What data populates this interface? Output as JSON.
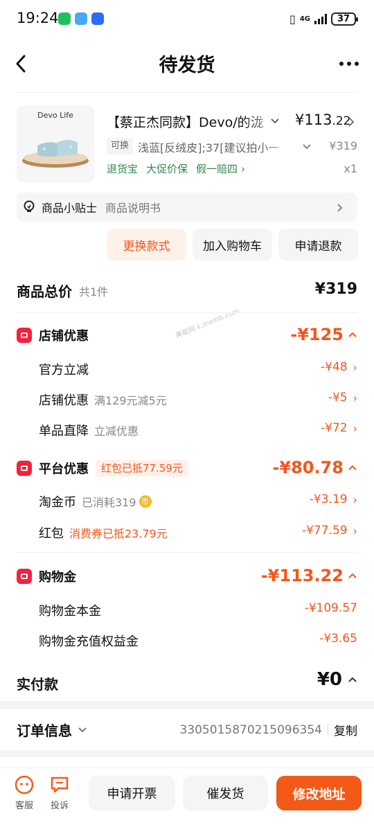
{
  "status_bar": {
    "time": "19:24",
    "network": "4G",
    "battery": "37"
  },
  "nav": {
    "title": "待发货"
  },
  "product": {
    "brand": "Devo Life",
    "title": "【蔡正杰同款】Devo/的泷",
    "price_main": "¥113",
    "price_decimal": ".22",
    "spec_tag": "可换",
    "spec": "浅蓝[反绒皮];37[建议拍小一",
    "original_price": "¥319",
    "service_tags": [
      "退货宝",
      "大促价保",
      "假一赔四"
    ],
    "quantity": "x1"
  },
  "tips": {
    "label": "商品小贴士",
    "sub": "商品说明书"
  },
  "actions": [
    "更换款式",
    "加入购物车",
    "申请退款"
  ],
  "totals": {
    "goods_total_label": "商品总价",
    "goods_total_count": "共1件",
    "goods_total_value": "¥319",
    "watermark": "美能网 k.meinb.com",
    "shop": {
      "label": "店铺优惠",
      "amount": "-¥125",
      "items": [
        {
          "label": "官方立减",
          "note": "",
          "amount": "-¥48"
        },
        {
          "label": "店铺优惠",
          "note": "满129元减5元",
          "amount": "-¥5"
        },
        {
          "label": "单品直降",
          "note": "立减优惠",
          "amount": "-¥72"
        }
      ]
    },
    "platform": {
      "label": "平台优惠",
      "pill": "红包已抵77.59元",
      "amount": "-¥80.78",
      "items": [
        {
          "label": "淘金币",
          "note": "已消耗319",
          "amount": "-¥3.19"
        },
        {
          "label": "红包",
          "note": "消费券已抵23.79元",
          "amount": "-¥77.59"
        }
      ]
    },
    "shopping_money": {
      "label": "购物金",
      "amount": "-¥113.22",
      "items": [
        {
          "label": "购物金本金",
          "amount": "-¥109.57"
        },
        {
          "label": "购物金充值权益金",
          "amount": "-¥3.65"
        }
      ]
    },
    "paid_label": "实付款",
    "paid_value": "¥0"
  },
  "order_info": {
    "label": "订单信息",
    "number": "3305015870215096354",
    "copy": "复制"
  },
  "bottom": {
    "service": "客服",
    "complaint": "投诉",
    "invoice": "申请开票",
    "urge": "催发货",
    "modify": "修改地址"
  },
  "colors": {
    "accent": "#f2571e",
    "primary_button": "#f35a17",
    "service_green": "#2f8a4c",
    "icon_red": "#f5213d"
  }
}
